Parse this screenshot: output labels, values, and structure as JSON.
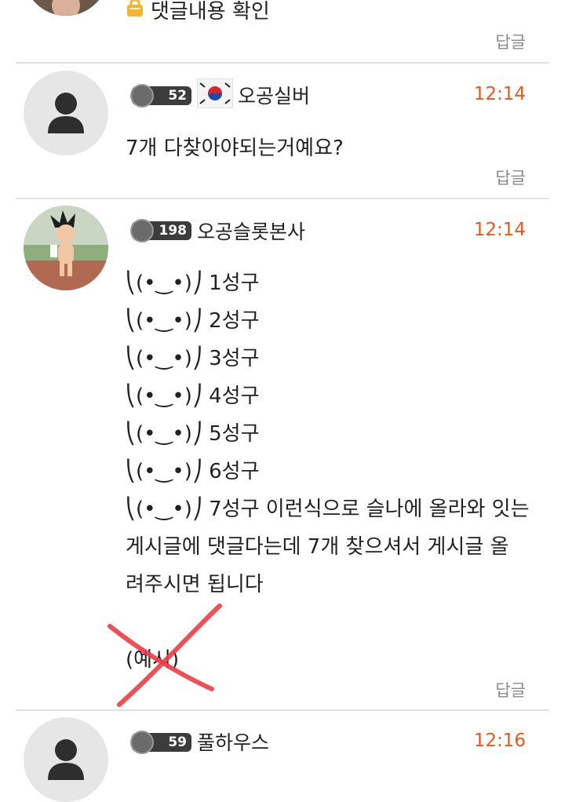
{
  "top": {
    "hidden_text": "댓글내용 확인",
    "reply_label": "답글"
  },
  "comments": [
    {
      "level": "52",
      "name": "오공실버",
      "time": "12:14",
      "lines": [
        "7개 다찾아야되는거예요?"
      ],
      "reply_label": "답글"
    },
    {
      "level": "198",
      "name": "오공슬롯본사",
      "time": "12:14",
      "lines": [
        "⎝(•‿•)⎠ 1성구",
        "⎝(•‿•)⎠ 2성구",
        "⎝(•‿•)⎠ 3성구",
        "⎝(•‿•)⎠ 4성구",
        "⎝(•‿•)⎠ 5성구",
        "⎝(•‿•)⎠ 6성구",
        "⎝(•‿•)⎠ 7성구 이런식으로 슬나에 올라와 잇는",
        "게시글에 댓글다는데 7개 찾으셔서 게시글 올",
        "려주시면 됩니다",
        "(예시)"
      ],
      "reply_label": "답글"
    },
    {
      "level": "59",
      "name": "풀하우스",
      "time": "12:16"
    }
  ],
  "colors": {
    "time": "#e45a1a",
    "reply": "#8a8a8a",
    "divider": "#e2e2e2",
    "x_mark": "#f03c46"
  }
}
